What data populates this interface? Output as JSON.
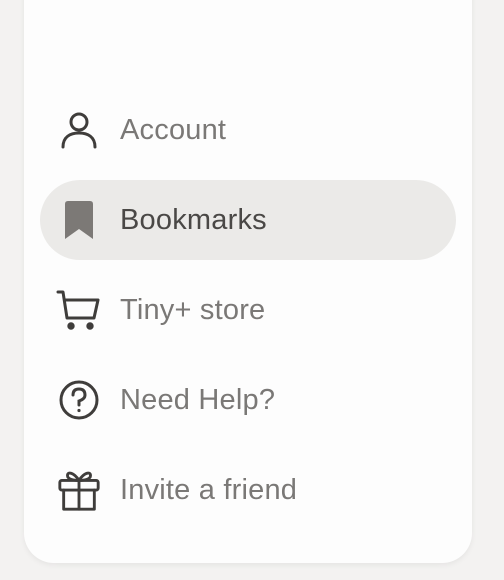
{
  "menu": {
    "items": [
      {
        "label": "Account",
        "icon": "user-icon",
        "active": false
      },
      {
        "label": "Bookmarks",
        "icon": "bookmark-icon",
        "active": true
      },
      {
        "label": "Tiny+ store",
        "icon": "cart-icon",
        "active": false
      },
      {
        "label": "Need Help?",
        "icon": "help-circle-icon",
        "active": false
      },
      {
        "label": "Invite a friend",
        "icon": "gift-icon",
        "active": false
      }
    ]
  },
  "colors": {
    "background": "#f3f2f1",
    "panel": "#fdfdfd",
    "active_bg": "#ebeae8",
    "icon_stroke": "#3f3d3b",
    "bookmark_fill": "#7c7976",
    "label": "#7a7876",
    "label_active": "#4a4846"
  }
}
